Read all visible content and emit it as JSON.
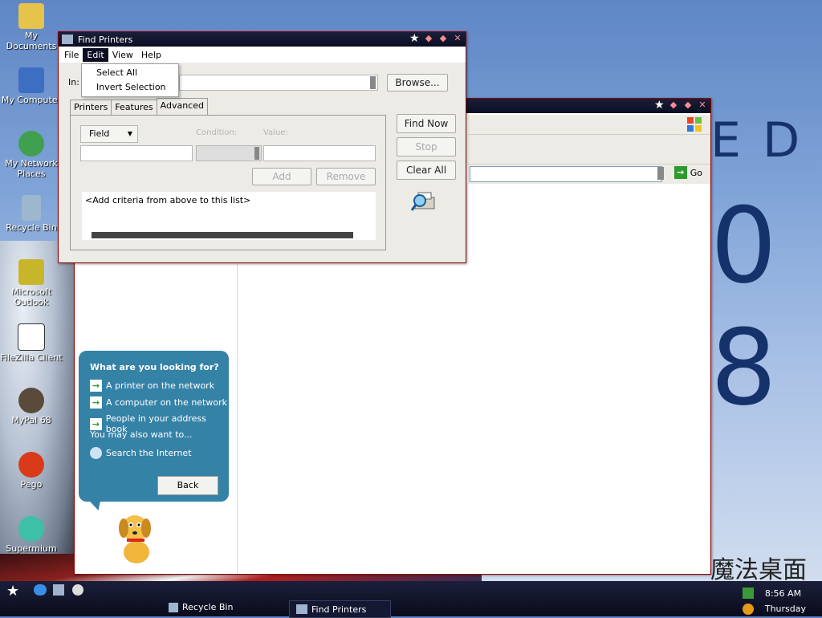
{
  "desktop": {
    "icons": [
      {
        "label": "My Documents"
      },
      {
        "label": "My Computer"
      },
      {
        "label": "My Network Places"
      },
      {
        "label": "Recycle Bin"
      },
      {
        "label": "Microsoft Outlook"
      },
      {
        "label": "FileZilla Client"
      },
      {
        "label": "MyPal 68"
      },
      {
        "label": "Pego"
      },
      {
        "label": "Supermium"
      }
    ],
    "wallpaper_text": {
      "ed": "E D",
      "eight": "0 8",
      "cn": "魔法桌面"
    }
  },
  "search_window": {
    "address": {
      "go_label": "Go"
    },
    "companion": {
      "title": "What are you looking for?",
      "items": [
        {
          "label": "A printer on the network"
        },
        {
          "label": "A computer on the network"
        },
        {
          "label": "People in your address book"
        }
      ],
      "also": "You may also want to...",
      "search_internet": "Search the Internet",
      "back_label": "Back"
    }
  },
  "find_printers": {
    "title": "Find Printers",
    "menu": [
      {
        "label": "File"
      },
      {
        "label": "Edit"
      },
      {
        "label": "View"
      },
      {
        "label": "Help"
      }
    ],
    "edit_menu": [
      {
        "label": "Select All"
      },
      {
        "label": "Invert Selection"
      }
    ],
    "in_label": "In:",
    "browse_label": "Browse...",
    "tabs": [
      {
        "label": "Printers"
      },
      {
        "label": "Features"
      },
      {
        "label": "Advanced"
      }
    ],
    "field_label": "Field",
    "condition_label": "Condition:",
    "value_label": "Value:",
    "add_label": "Add",
    "remove_label": "Remove",
    "list_placeholder": "<Add criteria from above to this list>",
    "find_now_label": "Find Now",
    "stop_label": "Stop",
    "clear_all_label": "Clear All"
  },
  "taskbar": {
    "items": [
      {
        "label": "Recycle Bin"
      },
      {
        "label": "Find Printers"
      }
    ],
    "clock": {
      "time": "8:56 AM",
      "day": "Thursday"
    }
  }
}
